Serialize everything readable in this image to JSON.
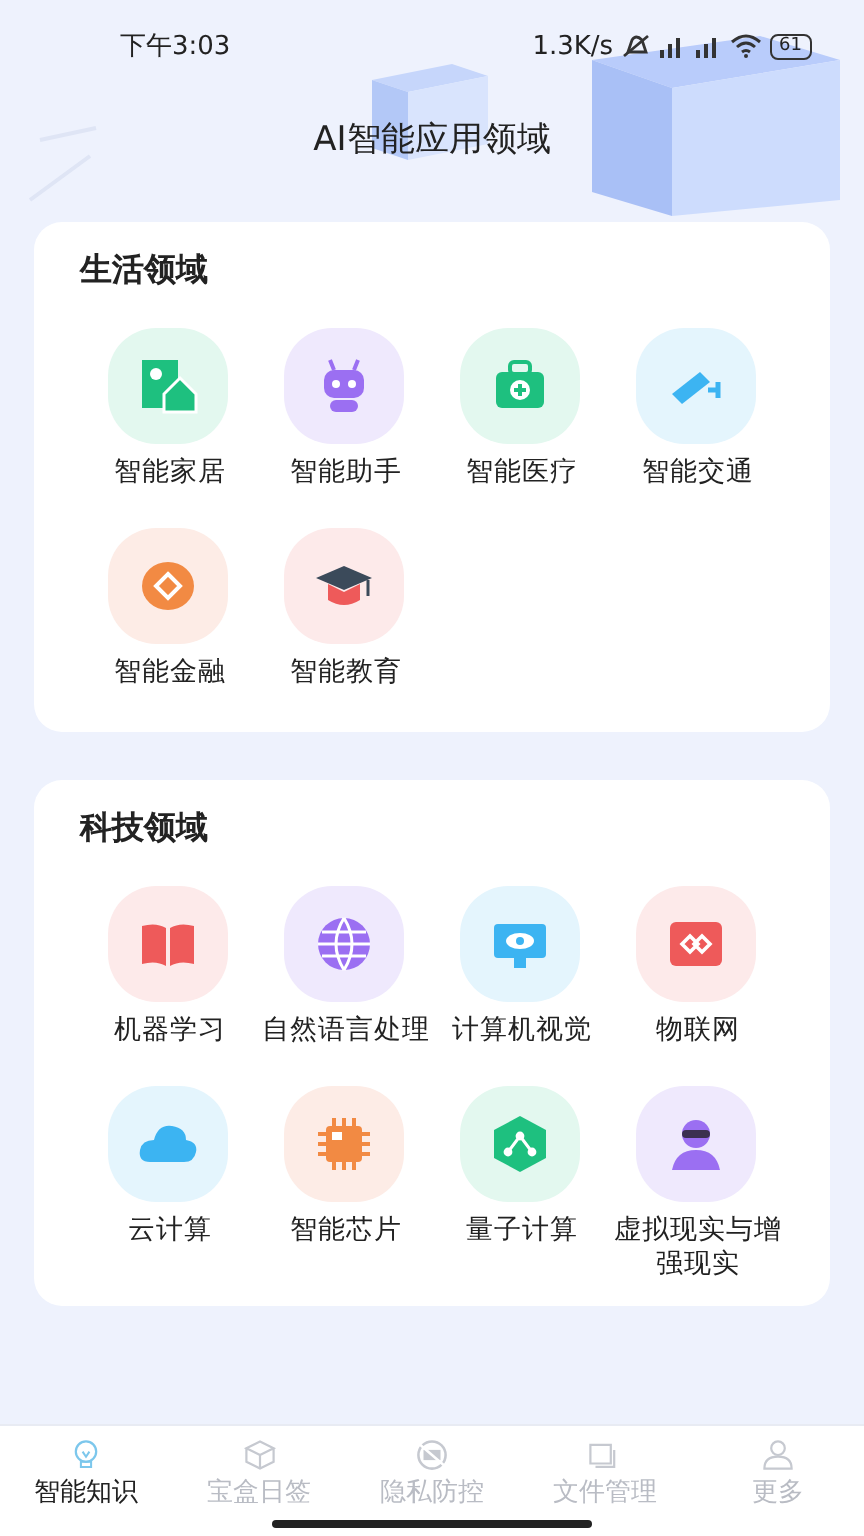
{
  "status_bar": {
    "time": "下午3:03",
    "speed": "1.3K/s",
    "battery": "61"
  },
  "title": "AI智能应用领域",
  "sections": [
    {
      "heading": "生活领域",
      "items": [
        {
          "label": "智能家居"
        },
        {
          "label": "智能助手"
        },
        {
          "label": "智能医疗"
        },
        {
          "label": "智能交通"
        },
        {
          "label": "智能金融"
        },
        {
          "label": "智能教育"
        }
      ]
    },
    {
      "heading": "科技领域",
      "items": [
        {
          "label": "机器学习"
        },
        {
          "label": "自然语言处理"
        },
        {
          "label": "计算机视觉"
        },
        {
          "label": "物联网"
        },
        {
          "label": "云计算"
        },
        {
          "label": "智能芯片"
        },
        {
          "label": "量子计算"
        },
        {
          "label": "虚拟现实与增强现实"
        }
      ]
    }
  ],
  "tabs": [
    {
      "label": "智能知识",
      "selected": true
    },
    {
      "label": "宝盒日签",
      "selected": false
    },
    {
      "label": "隐私防控",
      "selected": false
    },
    {
      "label": "文件管理",
      "selected": false
    },
    {
      "label": "更多",
      "selected": false
    }
  ]
}
